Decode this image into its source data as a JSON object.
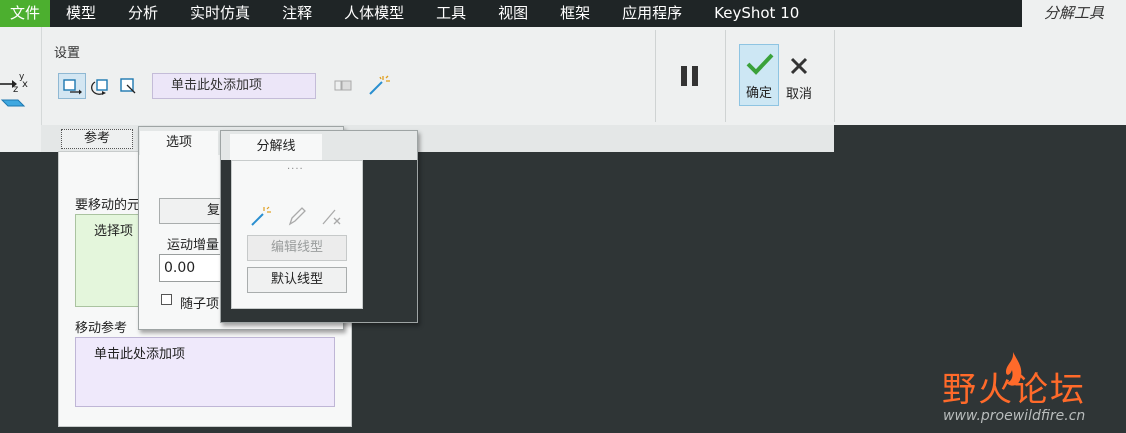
{
  "tabs": [
    {
      "label": "文件"
    },
    {
      "label": "模型"
    },
    {
      "label": "分析"
    },
    {
      "label": "实时仿真"
    },
    {
      "label": "注释"
    },
    {
      "label": "人体模型"
    },
    {
      "label": "工具"
    },
    {
      "label": "视图"
    },
    {
      "label": "框架"
    },
    {
      "label": "应用程序"
    },
    {
      "label": "KeyShot 10"
    },
    {
      "label": "分解工具"
    }
  ],
  "ribbon": {
    "settings_label": "设置",
    "collector_text": "单击此处添加项",
    "confirm_label": "确定",
    "cancel_label": "取消",
    "axis_icon_label": "y z x"
  },
  "panel_tabs": {
    "reference": "参考",
    "options": "选项",
    "explode_lines": "分解线"
  },
  "reference_panel": {
    "move_label": "要移动的元",
    "select_item_text": "选择项",
    "move_ref_label": "移动参考",
    "add_item_text": "单击此处添加项"
  },
  "options_panel": {
    "copy_button": "复",
    "increment_label": "运动增量",
    "increment_value": "0.00",
    "follow_children_label": "随子项"
  },
  "line_panel": {
    "grip_text": "....",
    "edit_style_button": "编辑线型",
    "default_style_button": "默认线型"
  },
  "watermark": {
    "title": "野火论坛",
    "url": "www.proewildfire.cn"
  },
  "colors": {
    "tab_bar": "#1f2526",
    "file_tab": "#4caf2f",
    "ribbon": "#eef0f0",
    "workspace": "#2f3536",
    "confirm_bg": "#cde7f4",
    "confirm_check": "#3aa13a",
    "collector": "#ece6f8",
    "select_box": "#e4f6dc",
    "watermark": "#ff6a2a"
  }
}
